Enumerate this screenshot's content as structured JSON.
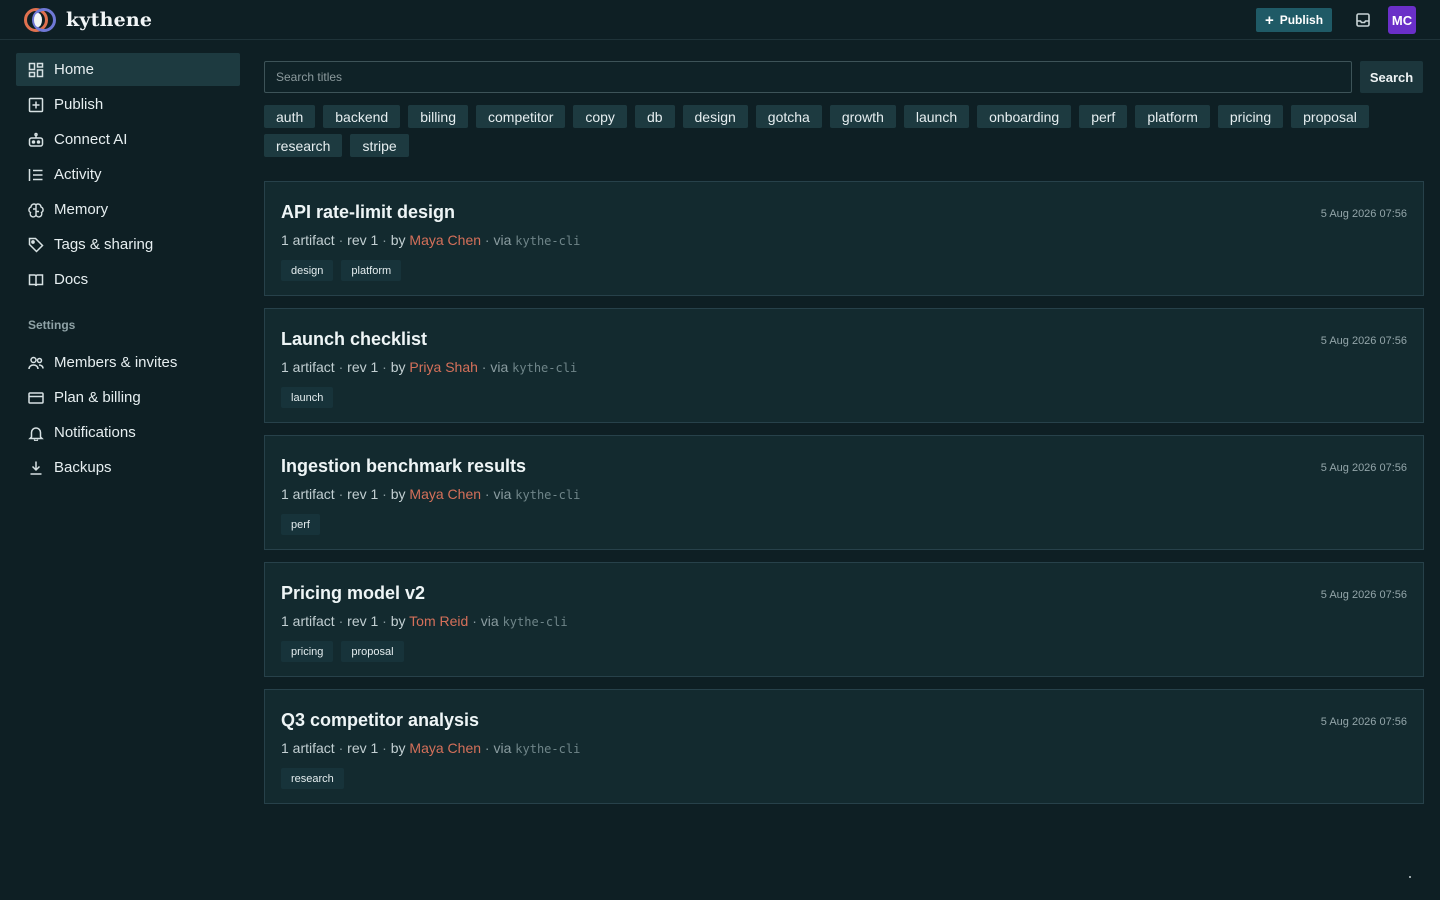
{
  "app": {
    "name": "kythene"
  },
  "header": {
    "publish_label": "Publish",
    "avatar_initials": "MC",
    "avatar_color": "#6a2fc8",
    "accent_color": "#1f5a66"
  },
  "sidebar": {
    "items": [
      {
        "label": "Home",
        "icon": "grid-icon",
        "active": true
      },
      {
        "label": "Publish",
        "icon": "plus-square-icon"
      },
      {
        "label": "Connect AI",
        "icon": "robot-icon"
      },
      {
        "label": "Activity",
        "icon": "activity-list-icon"
      },
      {
        "label": "Memory",
        "icon": "brain-icon"
      },
      {
        "label": "Tags & sharing",
        "icon": "tag-icon"
      },
      {
        "label": "Docs",
        "icon": "book-icon"
      }
    ],
    "settings_heading": "Settings",
    "settings_items": [
      {
        "label": "Members & invites",
        "icon": "people-icon"
      },
      {
        "label": "Plan & billing",
        "icon": "credit-card-icon"
      },
      {
        "label": "Notifications",
        "icon": "bell-icon"
      },
      {
        "label": "Backups",
        "icon": "download-icon"
      }
    ]
  },
  "search": {
    "placeholder": "Search titles",
    "button_label": "Search"
  },
  "tags": [
    "auth",
    "backend",
    "billing",
    "competitor",
    "copy",
    "db",
    "design",
    "gotcha",
    "growth",
    "launch",
    "onboarding",
    "perf",
    "platform",
    "pricing",
    "proposal",
    "research",
    "stripe"
  ],
  "cards": [
    {
      "title": "API rate-limit design",
      "artifacts": "1 artifact",
      "rev": "rev 1",
      "by_label": "by",
      "author": "Maya Chen",
      "via_label": "via",
      "via": "kythe-cli",
      "date": "5 Aug 2026 07:56",
      "tags": [
        "design",
        "platform"
      ]
    },
    {
      "title": "Launch checklist",
      "artifacts": "1 artifact",
      "rev": "rev 1",
      "by_label": "by",
      "author": "Priya Shah",
      "via_label": "via",
      "via": "kythe-cli",
      "date": "5 Aug 2026 07:56",
      "tags": [
        "launch"
      ]
    },
    {
      "title": "Ingestion benchmark results",
      "artifacts": "1 artifact",
      "rev": "rev 1",
      "by_label": "by",
      "author": "Maya Chen",
      "via_label": "via",
      "via": "kythe-cli",
      "date": "5 Aug 2026 07:56",
      "tags": [
        "perf"
      ]
    },
    {
      "title": "Pricing model v2",
      "artifacts": "1 artifact",
      "rev": "rev 1",
      "by_label": "by",
      "author": "Tom Reid",
      "via_label": "via",
      "via": "kythe-cli",
      "date": "5 Aug 2026 07:56",
      "tags": [
        "pricing",
        "proposal"
      ]
    },
    {
      "title": "Q3 competitor analysis",
      "artifacts": "1 artifact",
      "rev": "rev 1",
      "by_label": "by",
      "author": "Maya Chen",
      "via_label": "via",
      "via": "kythe-cli",
      "date": "5 Aug 2026 07:56",
      "tags": [
        "research"
      ]
    }
  ]
}
